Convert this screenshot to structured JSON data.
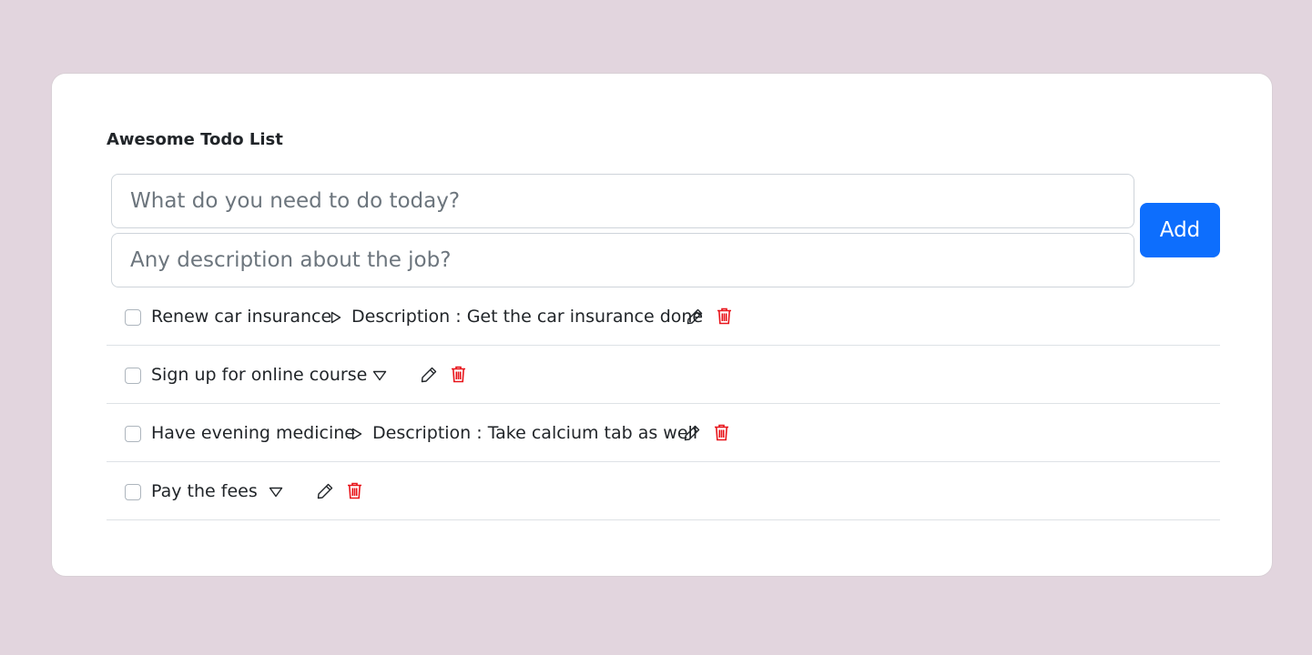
{
  "app": {
    "title": "Awesome Todo List"
  },
  "form": {
    "task_placeholder": "What do you need to do today?",
    "description_placeholder": "Any description about the job?",
    "add_label": "Add"
  },
  "todos": [
    {
      "title": "Renew car insurance",
      "expanded": true,
      "description": "Description : Get the car insurance done",
      "checked": false
    },
    {
      "title": "Sign up for online course",
      "expanded": false,
      "description": "",
      "checked": false
    },
    {
      "title": "Have evening medicine",
      "expanded": true,
      "description": "Description : Take calcium tab as well",
      "checked": false
    },
    {
      "title": "Pay the fees",
      "expanded": false,
      "description": "",
      "checked": false
    }
  ],
  "icons": {
    "expanded_toggle": "triangle-right-icon",
    "collapsed_toggle": "triangle-down-icon",
    "edit": "pencil-icon",
    "delete": "trash-icon"
  },
  "colors": {
    "background": "#e2d5de",
    "accent": "#0d6efd",
    "delete": "#e8151b"
  }
}
